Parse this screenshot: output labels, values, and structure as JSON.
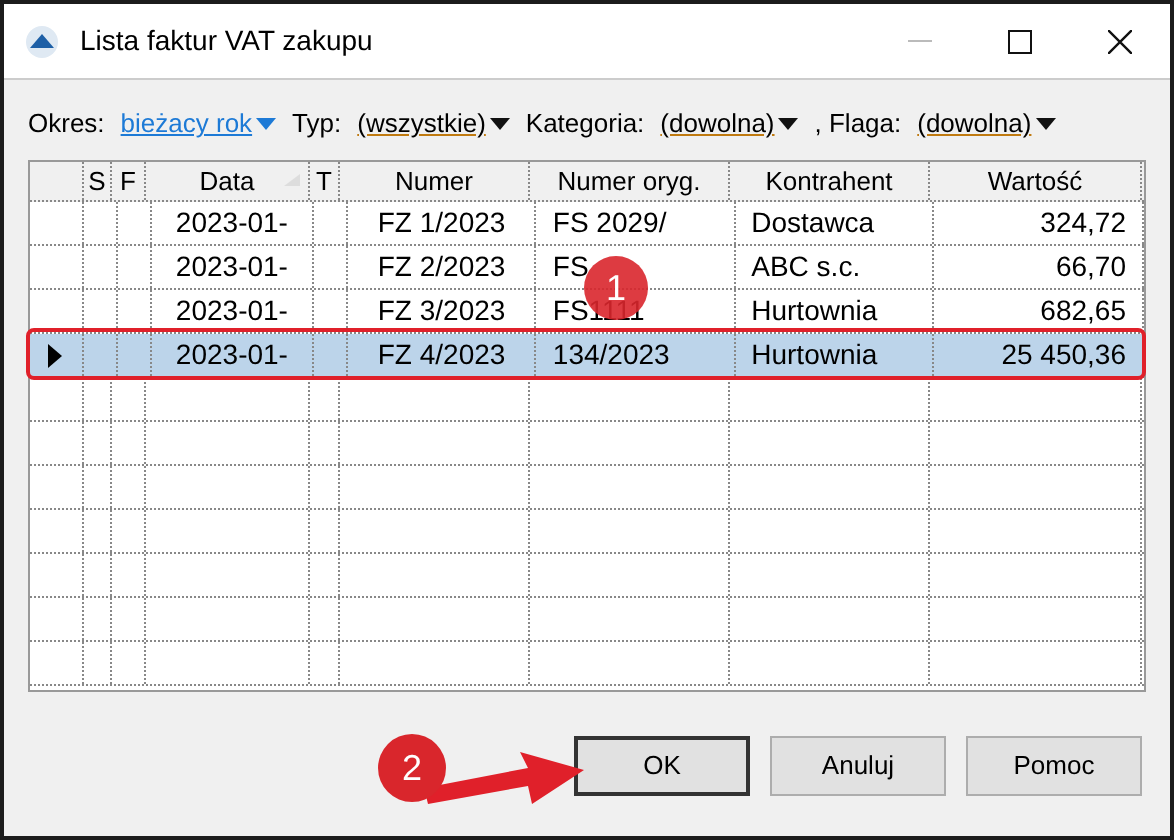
{
  "window": {
    "title": "Lista faktur VAT zakupu"
  },
  "filters": [
    {
      "label": "Okres:",
      "value": "bieżacy rok",
      "kind": "link"
    },
    {
      "label": "Typ:",
      "value": "(wszystkie)",
      "kind": "combo"
    },
    {
      "label": "Kategoria:",
      "value": "(dowolna)",
      "kind": "combo"
    },
    {
      "label": ", Flaga:",
      "value": "(dowolna)",
      "kind": "combo"
    }
  ],
  "table": {
    "columns": [
      "S",
      "F",
      "Data",
      "T",
      "Numer",
      "Numer oryg.",
      "Kontrahent",
      "Wartość"
    ],
    "rows": [
      {
        "selected": false,
        "cells": [
          "",
          "",
          "2023-01-",
          "",
          "FZ 1/2023",
          "FS 2029/",
          "Dostawca",
          "324,72"
        ]
      },
      {
        "selected": false,
        "cells": [
          "",
          "",
          "2023-01-",
          "",
          "FZ 2/2023",
          "FS",
          "ABC s.c.",
          "66,70"
        ]
      },
      {
        "selected": false,
        "cells": [
          "",
          "",
          "2023-01-",
          "",
          "FZ 3/2023",
          "FS1111",
          "Hurtownia",
          "682,65"
        ]
      },
      {
        "selected": true,
        "cells": [
          "",
          "",
          "2023-01-",
          "",
          "FZ 4/2023",
          "134/2023",
          "Hurtownia",
          "25 450,36"
        ]
      }
    ]
  },
  "buttons": [
    {
      "label": "OK",
      "default": true
    },
    {
      "label": "Anuluj",
      "default": false
    },
    {
      "label": "Pomoc",
      "default": false
    }
  ],
  "annotations": [
    {
      "label": "1"
    },
    {
      "label": "2"
    }
  ]
}
